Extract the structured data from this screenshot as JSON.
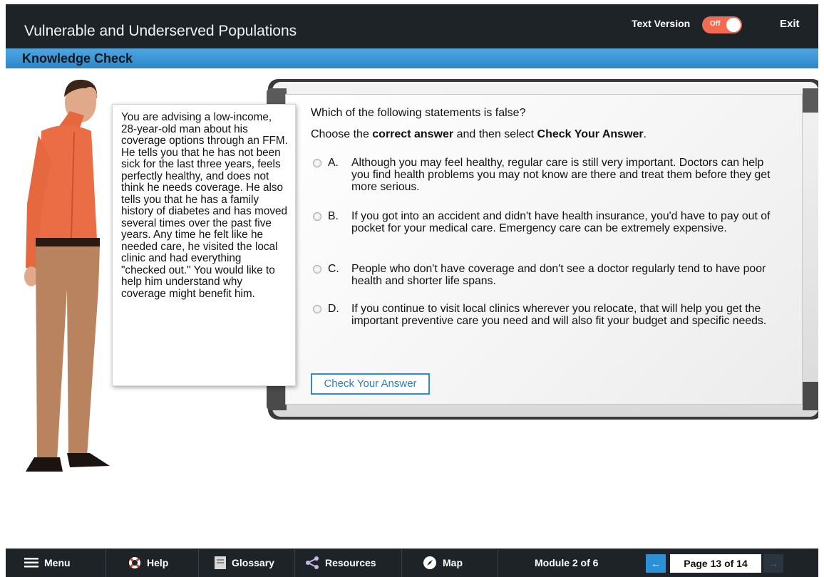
{
  "header": {
    "title": "Vulnerable and Underserved Populations",
    "text_version_label": "Text Version",
    "toggle_state": "Off",
    "exit_label": "Exit"
  },
  "subheader": {
    "title": "Knowledge Check"
  },
  "scenario": {
    "text": "You are advising a low-income, 28-year-old man about his coverage options through an FFM. He tells you that he has not been sick for the last three years, feels perfectly healthy, and does not think he needs coverage. He also tells you that he has a family history of diabetes and has moved several times over the past five years. Any time he felt like he needed care, he visited the local clinic and had everything \"checked out.\" You would like to help him understand why coverage might benefit him."
  },
  "question": {
    "prompt": "Which of the following statements is false?",
    "instruction_pre": "Choose the ",
    "instruction_bold1": "correct answer",
    "instruction_mid": " and then select ",
    "instruction_bold2": "Check Your Answer",
    "instruction_post": ".",
    "options": [
      {
        "letter": "A.",
        "text": "Although you may feel healthy, regular care is still very important. Doctors can help you find health problems you may not know are there and treat them before they get more serious."
      },
      {
        "letter": "B.",
        "text": "If you got into an accident and didn't have health insurance, you'd have to pay out of pocket for your medical care. Emergency care can be extremely expensive."
      },
      {
        "letter": "C.",
        "text": "People who don't have coverage and don't see a doctor regularly tend to have poor health and shorter life spans."
      },
      {
        "letter": "D.",
        "text": "If you continue to visit local clinics wherever you relocate, that will help you get the important preventive care you need and will also fit your budget and specific needs."
      }
    ],
    "check_button": "Check Your Answer"
  },
  "nav": {
    "menu": "Menu",
    "help": "Help",
    "glossary": "Glossary",
    "resources": "Resources",
    "map": "Map",
    "module": "Module 2 of 6",
    "page": "Page 13 of 14",
    "prev_icon": "arrow-left",
    "next_icon": "arrow-right"
  },
  "colors": {
    "header_bg": "#1d2327",
    "subheader_blue": "#3a95d8",
    "toggle_orange": "#f26a4f",
    "accent_blue": "#2e8cd1"
  }
}
